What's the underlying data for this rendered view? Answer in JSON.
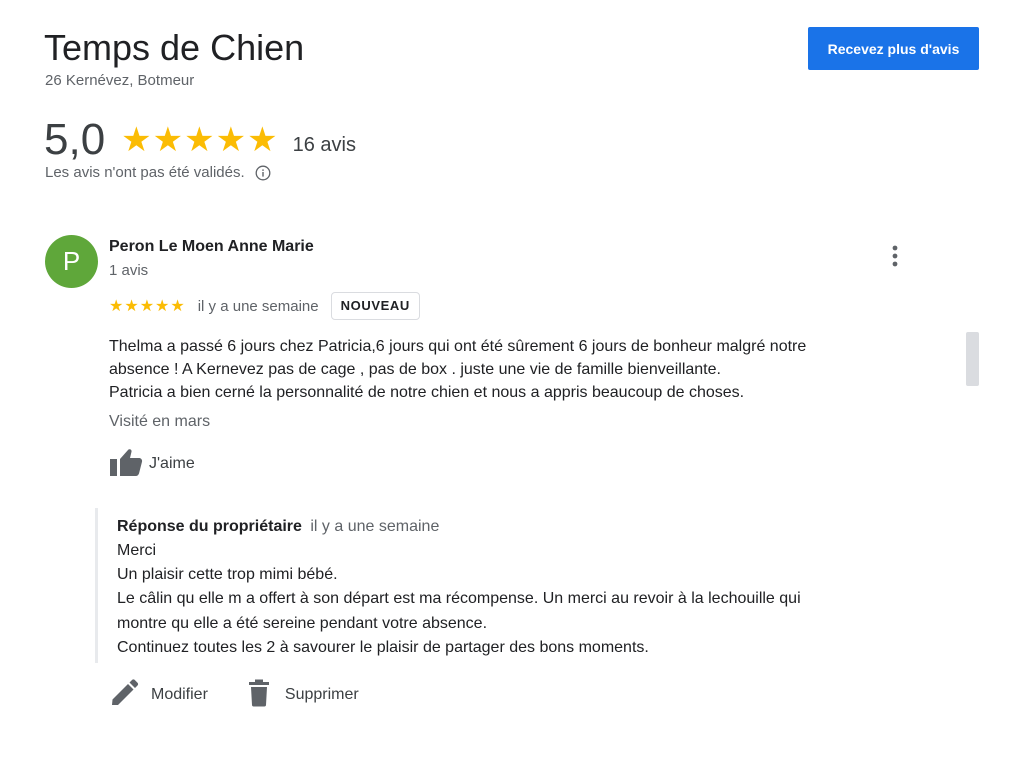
{
  "business": {
    "name": "Temps de Chien",
    "address": "26 Kernévez, Botmeur"
  },
  "cta": {
    "label": "Recevez plus d'avis"
  },
  "summary": {
    "score": "5,0",
    "stars": 5,
    "stars_display": "★★★★★",
    "count_label": "16 avis",
    "unverified_note": "Les avis n'ont pas été validés."
  },
  "review": {
    "avatar_initial": "P",
    "avatar_color": "#5fa73a",
    "author": "Peron Le Moen Anne Marie",
    "author_reviews": "1 avis",
    "rating": 5,
    "stars_display": "★★★★★",
    "date": "il y a une semaine",
    "badge": "NOUVEAU",
    "text_lines": [
      "Thelma a passé 6 jours chez Patricia,6 jours qui ont été sûrement 6 jours de bonheur malgré notre",
      "absence  ! A Kernevez pas de cage , pas de box . juste une vie de famille bienveillante.",
      "Patricia a bien cerné la personnalité de notre chien et nous a appris beaucoup de choses."
    ],
    "visited": "Visité en mars",
    "like_label": "J'aime"
  },
  "owner_response": {
    "title": "Réponse du propriétaire",
    "date": "il y a une semaine",
    "lines": [
      "Merci",
      "Un plaisir cette trop mimi bébé.",
      "Le câlin qu elle m a offert à son départ est ma récompense. Un merci au revoir à la lechouille qui",
      "montre qu elle a été sereine pendant votre absence.",
      "Continuez toutes les 2 à savourer le plaisir de partager des bons moments."
    ]
  },
  "actions": {
    "edit_label": "Modifier",
    "delete_label": "Supprimer"
  },
  "colors": {
    "accent": "#1a73e8",
    "star": "#fbbc04",
    "secondary_text": "#5f6368"
  },
  "icons": {
    "info": "info-icon",
    "more": "more-vert-icon",
    "like": "thumb-up-icon",
    "edit": "pencil-icon",
    "delete": "trash-icon"
  }
}
